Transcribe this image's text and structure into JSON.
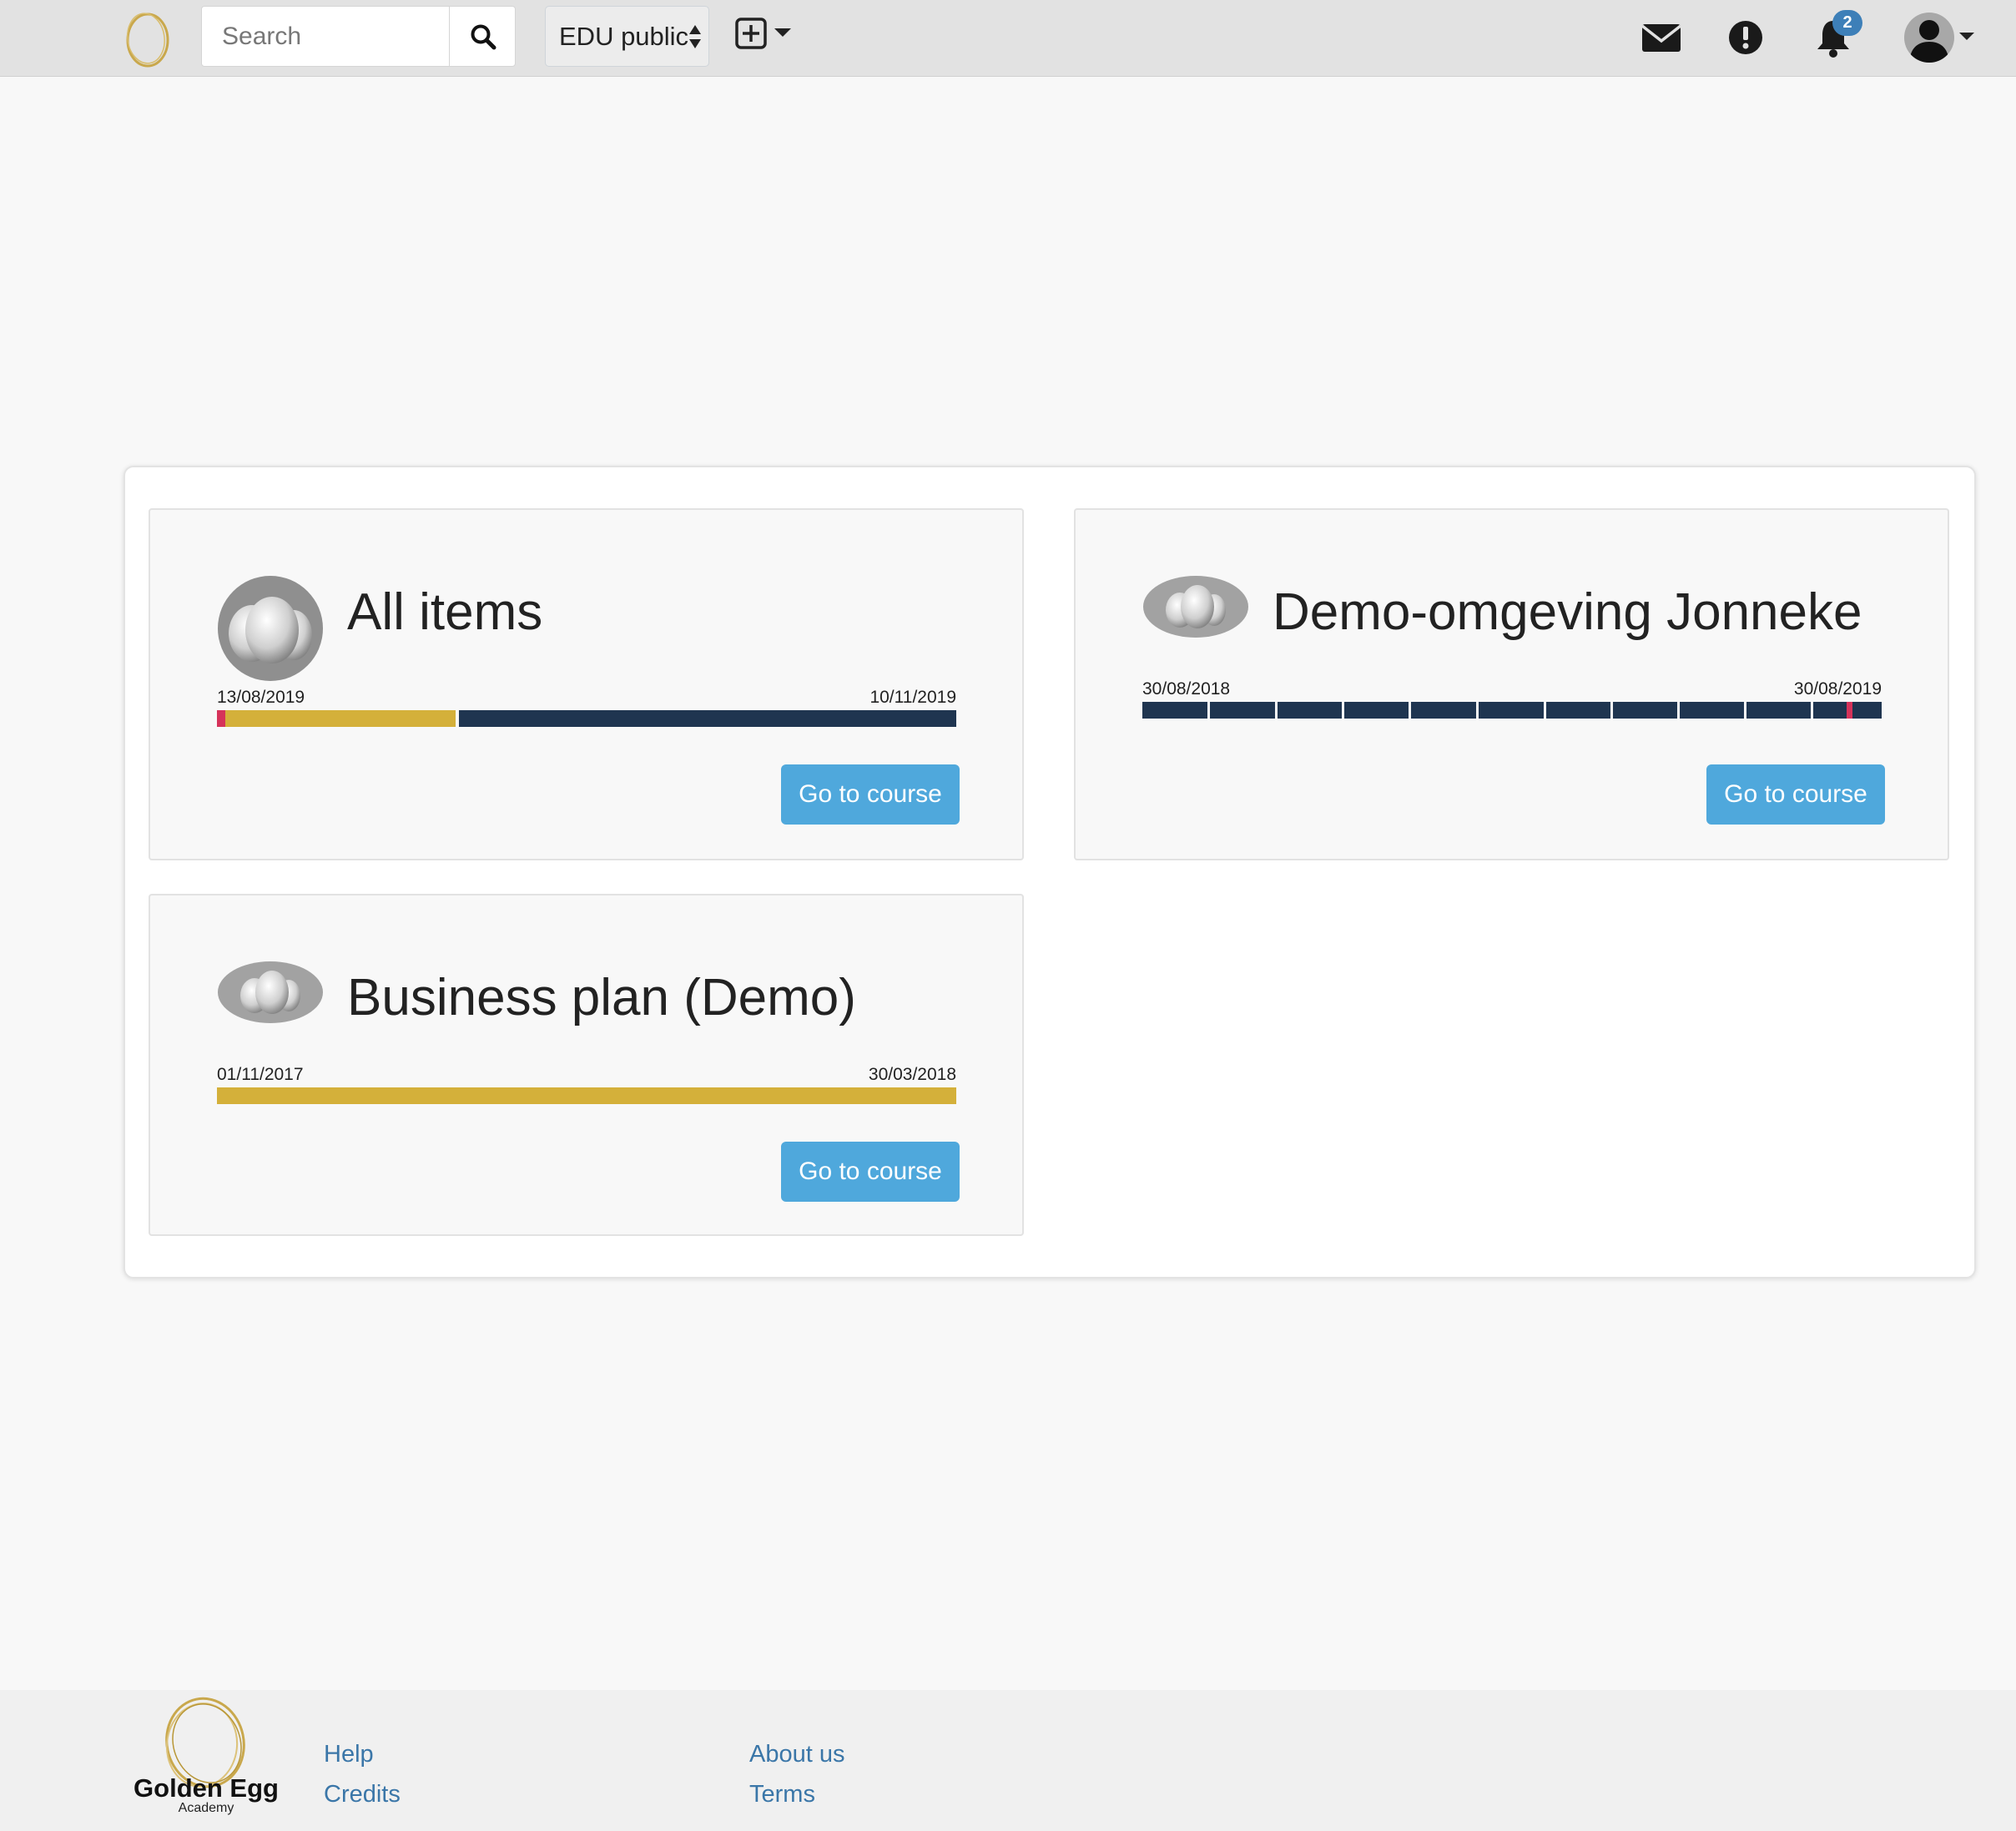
{
  "navbar": {
    "search": {
      "placeholder": "Search",
      "value": ""
    },
    "environment_select": {
      "value": "EDU public"
    },
    "notifications_count": "2"
  },
  "courses": [
    {
      "title": "All items",
      "start_date": "13/08/2019",
      "end_date": "10/11/2019",
      "button_label": "Go to course"
    },
    {
      "title": "Demo-omgeving Jonneke",
      "start_date": "30/08/2018",
      "end_date": "30/08/2019",
      "button_label": "Go to course"
    },
    {
      "title": "Business plan (Demo)",
      "start_date": "01/11/2017",
      "end_date": "30/03/2018",
      "button_label": "Go to course"
    }
  ],
  "footer": {
    "brand": "Golden Egg",
    "sub": "Academy",
    "links": [
      "Help",
      "Credits",
      "About us",
      "Terms"
    ]
  },
  "colors": {
    "navbar_bg": "#e2e2e2",
    "button_blue": "#4fa8dc",
    "timeline_gold": "#d4b03a",
    "timeline_navy": "#1f3550",
    "timeline_marker": "#d6335a",
    "link_blue": "#3a76a8",
    "badge_blue": "#3d7fb8"
  }
}
